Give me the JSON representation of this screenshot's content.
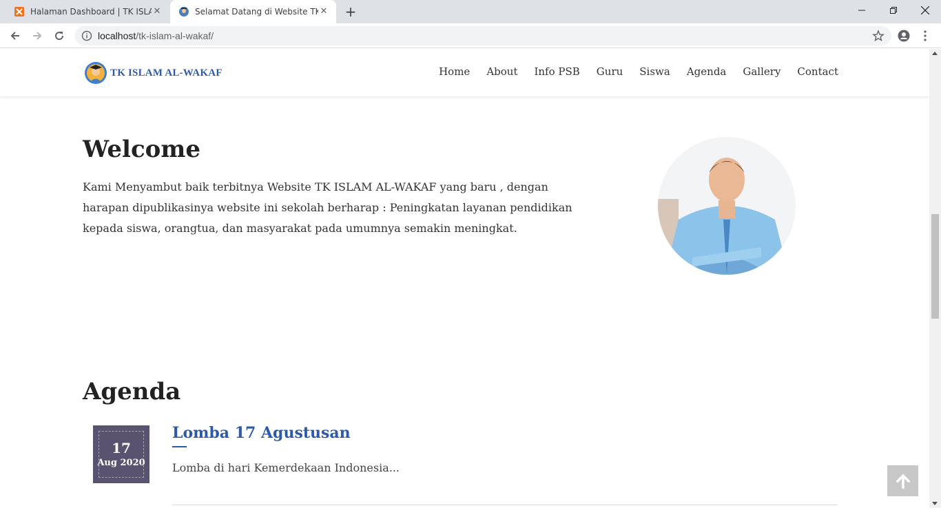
{
  "browser": {
    "tabs": [
      {
        "title": "Halaman Dashboard | TK ISLAM AL-WAKAF",
        "favicon": "xampp-icon",
        "active": false
      },
      {
        "title": "Selamat Datang di Website TK ISLAM AL-WAKAF",
        "favicon": "school-logo-icon",
        "active": true
      }
    ],
    "address": {
      "host": "localhost",
      "path": "/tk-islam-al-wakaf/"
    }
  },
  "site": {
    "brand": "TK ISLAM AL-WAKAF",
    "nav": [
      "Home",
      "About",
      "Info PSB",
      "Guru",
      "Siswa",
      "Agenda",
      "Gallery",
      "Contact"
    ]
  },
  "welcome": {
    "title": "Welcome",
    "text": "Kami Menyambut baik terbitnya Website TK ISLAM AL-WAKAF yang baru , dengan harapan dipublikasinya website ini sekolah berharap : Peningkatan layanan pendidikan kepada siswa, orangtua, dan masyarakat pada umumnya semakin meningkat."
  },
  "agenda": {
    "title": "Agenda",
    "items": [
      {
        "day": "17",
        "month": "Aug 2020",
        "title": "Lomba 17 Agustusan",
        "desc": "Lomba di hari Kemerdekaan Indonesia..."
      }
    ]
  },
  "colors": {
    "brand_blue": "#2d5aa8",
    "date_box": "#5a5370",
    "back_to_top": "#c8c8c8"
  }
}
